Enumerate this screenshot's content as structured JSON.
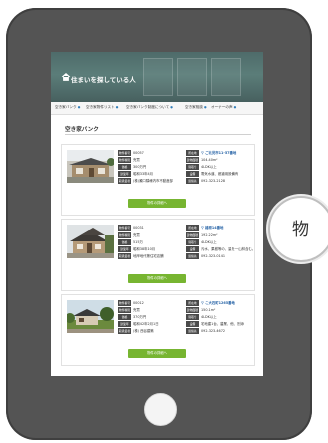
{
  "hero": {
    "title": "住まいを探している人"
  },
  "menu": {
    "items": [
      "空き家バンク",
      "空き家物件リスト",
      "空き家バンク制度について",
      "空き家相談",
      "オーナーの声"
    ]
  },
  "page": {
    "title": "空き家バンク"
  },
  "listings": [
    {
      "rows_left": [
        {
          "label": "物件番号",
          "value": "00057"
        },
        {
          "label": "物件種別",
          "value": "売買"
        },
        {
          "label": "価格",
          "value": "300万円"
        },
        {
          "label": "建築年",
          "value": "昭和33年4月"
        },
        {
          "label": "取扱業者",
          "value": "(株)瀬口隣様内市不動産部"
        }
      ],
      "rows_right": [
        {
          "label": "所在地",
          "value": "ご北見市11-57番地",
          "link": true
        },
        {
          "label": "建物面積",
          "value": "104.40m²"
        },
        {
          "label": "間取り",
          "value": "4LDK以上"
        },
        {
          "label": "設備",
          "value": "電気水道、都道用設備有"
        },
        {
          "label": "連絡先",
          "value": "092-323-2128"
        }
      ],
      "button": "物件の詳細へ"
    },
    {
      "rows_left": [
        {
          "label": "物件番号",
          "value": "00031"
        },
        {
          "label": "物件種別",
          "value": "売買"
        },
        {
          "label": "価格",
          "value": "515万"
        },
        {
          "label": "建築年",
          "value": "昭和38年10月"
        },
        {
          "label": "取扱業者",
          "value": "地岸地代第住宅店舗"
        }
      ],
      "rows_right": [
        {
          "label": "所在地",
          "value": "椿原14番地",
          "link": true
        },
        {
          "label": "建物面積",
          "value": "192.22m²"
        },
        {
          "label": "間取り",
          "value": "4LDK以上"
        },
        {
          "label": "設備",
          "value": "汚水、果樹等の、量を一山林含む。"
        },
        {
          "label": "連絡先",
          "value": "092-323-0141"
        }
      ],
      "button": "物件の詳細へ"
    },
    {
      "rows_left": [
        {
          "label": "物件番号",
          "value": "00012"
        },
        {
          "label": "物件種別",
          "value": "売買"
        },
        {
          "label": "価格",
          "value": "370万円"
        },
        {
          "label": "建築年",
          "value": "昭和42年2月1日"
        },
        {
          "label": "取扱業者",
          "value": "(株) 西谷建築"
        }
      ],
      "rows_right": [
        {
          "label": "所在地",
          "value": "こ大石町1265番地",
          "link": true
        },
        {
          "label": "建物面積",
          "value": "150.1m²"
        },
        {
          "label": "間取り",
          "value": "4LDK以上"
        },
        {
          "label": "設備",
          "value": "宅地建1台、農業、他、別添"
        },
        {
          "label": "連絡先",
          "value": "092-323-4672"
        }
      ],
      "button": "物件の詳細へ"
    }
  ],
  "side_badge": {
    "text": "物"
  },
  "colors": {
    "tablet": "#545454",
    "hero": "#577672",
    "button": "#77b531",
    "link": "#2a66a8"
  }
}
